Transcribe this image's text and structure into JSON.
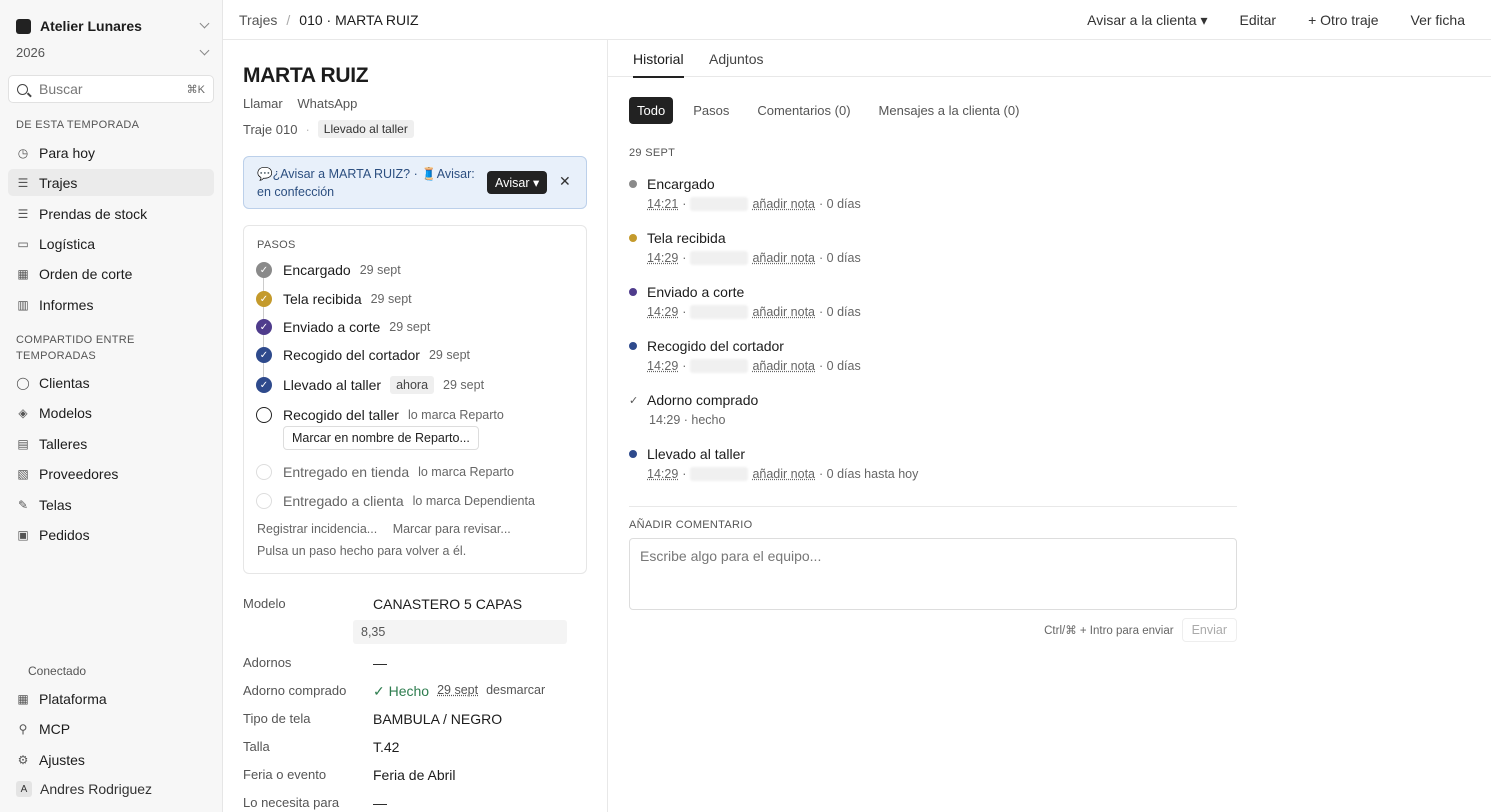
{
  "sidebar": {
    "workspace": "Atelier Lunares",
    "year": "2026",
    "search": {
      "placeholder": "Buscar",
      "shortcut": "⌘K"
    },
    "section_season": "DE ESTA TEMPORADA",
    "season_items": [
      {
        "label": "Para hoy",
        "icon": "clock-icon"
      },
      {
        "label": "Trajes",
        "icon": "stack-icon"
      },
      {
        "label": "Prendas de stock",
        "icon": "stack-icon"
      },
      {
        "label": "Logística",
        "icon": "truck-icon"
      },
      {
        "label": "Orden de corte",
        "icon": "grid-icon"
      },
      {
        "label": "Informes",
        "icon": "chart-icon"
      }
    ],
    "section_shared": "COMPARTIDO ENTRE TEMPORADAS",
    "shared_items": [
      {
        "label": "Clientas",
        "icon": "user-icon"
      },
      {
        "label": "Modelos",
        "icon": "cube-icon"
      },
      {
        "label": "Talleres",
        "icon": "building-icon"
      },
      {
        "label": "Proveedores",
        "icon": "factory-icon"
      },
      {
        "label": "Telas",
        "icon": "pencil-icon"
      },
      {
        "label": "Pedidos",
        "icon": "box-icon"
      }
    ],
    "connected": "Conectado",
    "bottom_items": [
      {
        "label": "Plataforma",
        "icon": "grid-icon"
      },
      {
        "label": "MCP",
        "icon": "plug-icon"
      },
      {
        "label": "Ajustes",
        "icon": "gear-icon"
      }
    ],
    "user": {
      "initial": "A",
      "name": "Andres Rodriguez"
    }
  },
  "topbar": {
    "crumb_root": "Trajes",
    "crumb_sep": "/",
    "crumb_current": "010 · MARTA RUIZ",
    "actions": [
      "Avisar a la clienta ▾",
      "Editar",
      "+ Otro traje",
      "Ver ficha"
    ]
  },
  "detail": {
    "name": "MARTA RUIZ",
    "contact": [
      "Llamar",
      "WhatsApp"
    ],
    "traje": "Traje 010",
    "traje_sep": "·",
    "status": "Llevado al taller",
    "alert": {
      "text": "💬¿Avisar a MARTA RUIZ? · 🧵Avisar: en confección",
      "button": "Avisar ▾",
      "close": "✕"
    },
    "steps_title": "PASOS",
    "steps": [
      {
        "label": "Encargado",
        "date": "29 sept",
        "state": "grey"
      },
      {
        "label": "Tela recibida",
        "date": "29 sept",
        "state": "gold"
      },
      {
        "label": "Enviado a corte",
        "date": "29 sept",
        "state": "purple"
      },
      {
        "label": "Recogido del cortador",
        "date": "29 sept",
        "state": "navy"
      },
      {
        "label": "Llevado al taller",
        "now": "ahora",
        "date": "29 sept",
        "state": "navy"
      },
      {
        "label": "Recogido del taller",
        "date": "lo marca Reparto",
        "state": "open"
      },
      {
        "label": "Entregado en tienda",
        "date": "lo marca Reparto",
        "state": "pending"
      },
      {
        "label": "Entregado a clienta",
        "date": "lo marca Dependienta",
        "state": "pending"
      }
    ],
    "mark_button": "Marcar en nombre de Reparto...",
    "links": [
      "Registrar incidencia...",
      "Marcar para revisar..."
    ],
    "hint": "Pulsa un paso hecho para volver a él.",
    "fields": {
      "modelo_label": "Modelo",
      "modelo": "CANASTERO 5 CAPAS",
      "price": "8,35",
      "adornos_label": "Adornos",
      "adornos": "—",
      "adorno_comprado_label": "Adorno comprado",
      "adorno_done": "✓ Hecho",
      "adorno_date": "29 sept",
      "adorno_unmark": "desmarcar",
      "tela_label": "Tipo de tela",
      "tela": "BAMBULA / NEGRO",
      "talla_label": "Talla",
      "talla": "T.42",
      "feria_label": "Feria o evento",
      "feria": "Feria de Abril",
      "necesita_label": "Lo necesita para",
      "necesita": "—"
    }
  },
  "history": {
    "tabs": [
      "Historial",
      "Adjuntos"
    ],
    "filters": [
      "Todo",
      "Pasos",
      "Comentarios (0)",
      "Mensajes a la clienta (0)"
    ],
    "date_header": "29 SEPT",
    "events": [
      {
        "title": "Encargado",
        "time": "14:21",
        "note": "añadir nota",
        "days": "· 0 días",
        "color": "#8a8a8a"
      },
      {
        "title": "Tela recibida",
        "time": "14:29",
        "note": "añadir nota",
        "days": "· 0 días",
        "color": "#c49a2c"
      },
      {
        "title": "Enviado a corte",
        "time": "14:29",
        "note": "añadir nota",
        "days": "· 0 días",
        "color": "#4f3c8c"
      },
      {
        "title": "Recogido del cortador",
        "time": "14:29",
        "note": "añadir nota",
        "days": "· 0 días",
        "color": "#2e4a8c"
      },
      {
        "title": "Adorno comprado",
        "meta": "14:29 · hecho"
      },
      {
        "title": "Llevado al taller",
        "time": "14:29",
        "note": "añadir nota",
        "days": "· 0 días hasta hoy",
        "color": "#2e4a8c"
      }
    ],
    "add_comment": "AÑADIR COMENTARIO",
    "comment_placeholder": "Escribe algo para el equipo...",
    "send_hint": "Ctrl/⌘ + Intro para enviar",
    "send": "Enviar"
  }
}
